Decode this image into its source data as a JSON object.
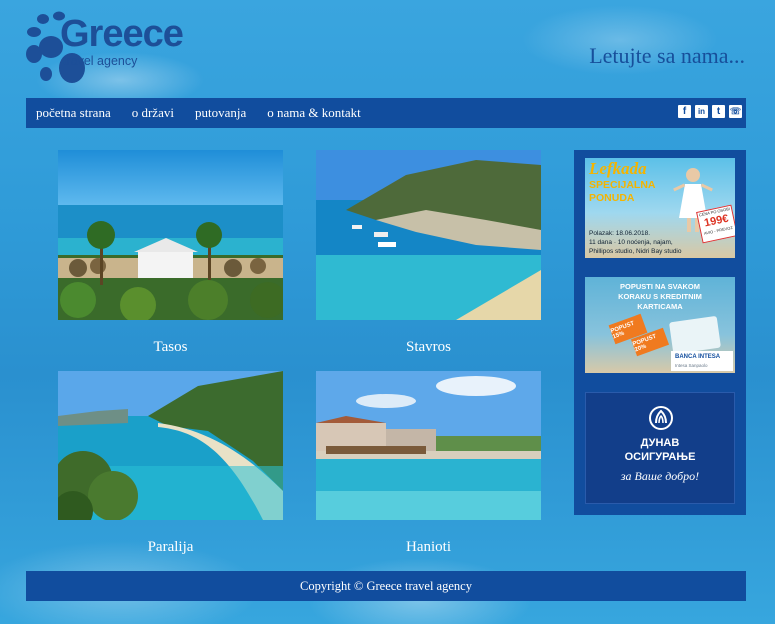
{
  "logo": {
    "word": "Greece",
    "sub": "travel agency"
  },
  "tagline": "Letujte sa nama...",
  "nav": {
    "links": [
      "početna strana",
      "o državi",
      "putovanja",
      "o nama & kontakt"
    ],
    "socials": [
      {
        "icon": "facebook-icon",
        "glyph": "f"
      },
      {
        "icon": "linkedin-icon",
        "glyph": "in"
      },
      {
        "icon": "twitter-icon",
        "glyph": "t"
      },
      {
        "icon": "whatsapp-icon",
        "glyph": "☏"
      }
    ]
  },
  "destinations": [
    "Tasos",
    "Stavros",
    "Paralija",
    "Hanioti"
  ],
  "ads": {
    "lefkada": {
      "title": "Lefkada",
      "line1": "SPECIJALNA",
      "line2": "PONUDA",
      "price": "199€",
      "price_top": "CENA PO OSOBI",
      "price_bottom": "AVIO - PREVOZ",
      "depart": "Polazak: 18.06.2018.",
      "details": "11 dana · 10 noćenja, najam,",
      "studios": "Phillipos studio, Nidri Bay studio"
    },
    "intesa": {
      "headline1": "POPUSTI NA SVAKOM",
      "headline2": "KORAKU S KREDITNIM",
      "headline3": "KARTICAMA",
      "brand": "BANCA INTESA",
      "brand_sub": "Intesa Sanpaolo",
      "tag1": "POPUST 15%",
      "tag2": "POPUST 20%"
    },
    "dunav": {
      "name1": "ДУНАВ",
      "name2": "ОСИГУРАЊЕ",
      "slogan": "за Ваше добро!"
    }
  },
  "footer": "Copyright © Greece travel agency"
}
